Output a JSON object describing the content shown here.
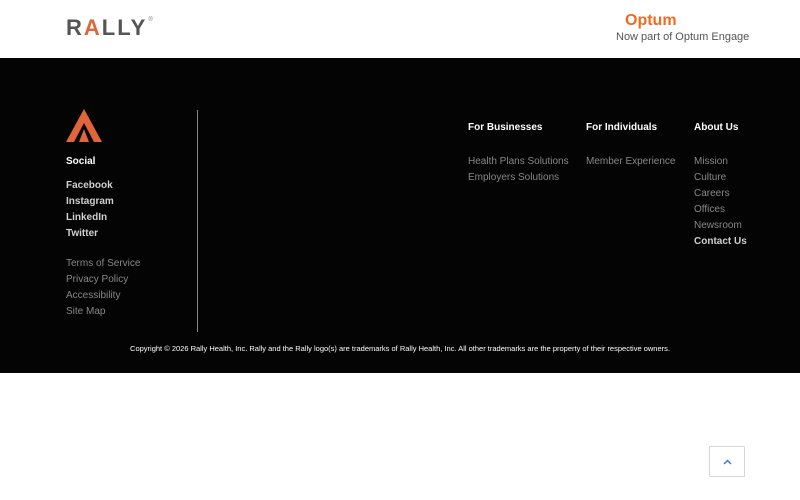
{
  "header": {
    "logo_text": "RALLY",
    "optum": {
      "brand": "Optum",
      "subtitle": "Now part of Optum Engage"
    }
  },
  "footer": {
    "social": {
      "heading": "Social",
      "links": [
        "Facebook",
        "Instagram",
        "LinkedIn",
        "Twitter"
      ]
    },
    "legal_links": [
      "Terms of Service",
      "Privacy Policy",
      "Accessibility",
      "Site Map"
    ],
    "columns": [
      {
        "heading": "For Businesses",
        "links": [
          "Health Plans Solutions",
          "Employers Solutions"
        ]
      },
      {
        "heading": "For Individuals",
        "links": [
          "Member Experience"
        ]
      },
      {
        "heading": "About Us",
        "links": [
          "Mission",
          "Culture",
          "Careers",
          "Offices",
          "Newsroom",
          "Contact Us"
        ]
      }
    ],
    "copyright": "Copyright © 2026 Rally Health, Inc. Rally and the Rally logo(s) are trademarks of Rally Health, Inc. All other trademarks are the property of their respective owners."
  },
  "icons": {
    "footer_logo": "rally-mark-icon",
    "scroll_top": "chevron-up-icon"
  },
  "colors": {
    "accent": "#e0653a",
    "optum": "#f26a22",
    "footer_bg": "#040404"
  }
}
